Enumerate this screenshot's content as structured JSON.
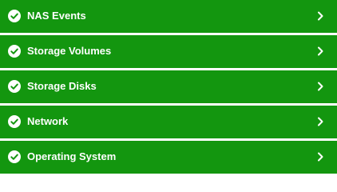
{
  "colors": {
    "row_background": "#13960f",
    "text": "#ffffff",
    "separator": "#ffffff"
  },
  "status_list": {
    "items": [
      {
        "label": "NAS Events",
        "status_icon": "check-circle-icon",
        "chevron_icon": "chevron-right-icon"
      },
      {
        "label": "Storage Volumes",
        "status_icon": "check-circle-icon",
        "chevron_icon": "chevron-right-icon"
      },
      {
        "label": "Storage Disks",
        "status_icon": "check-circle-icon",
        "chevron_icon": "chevron-right-icon"
      },
      {
        "label": "Network",
        "status_icon": "check-circle-icon",
        "chevron_icon": "chevron-right-icon"
      },
      {
        "label": "Operating System",
        "status_icon": "check-circle-icon",
        "chevron_icon": "chevron-right-icon"
      }
    ]
  }
}
